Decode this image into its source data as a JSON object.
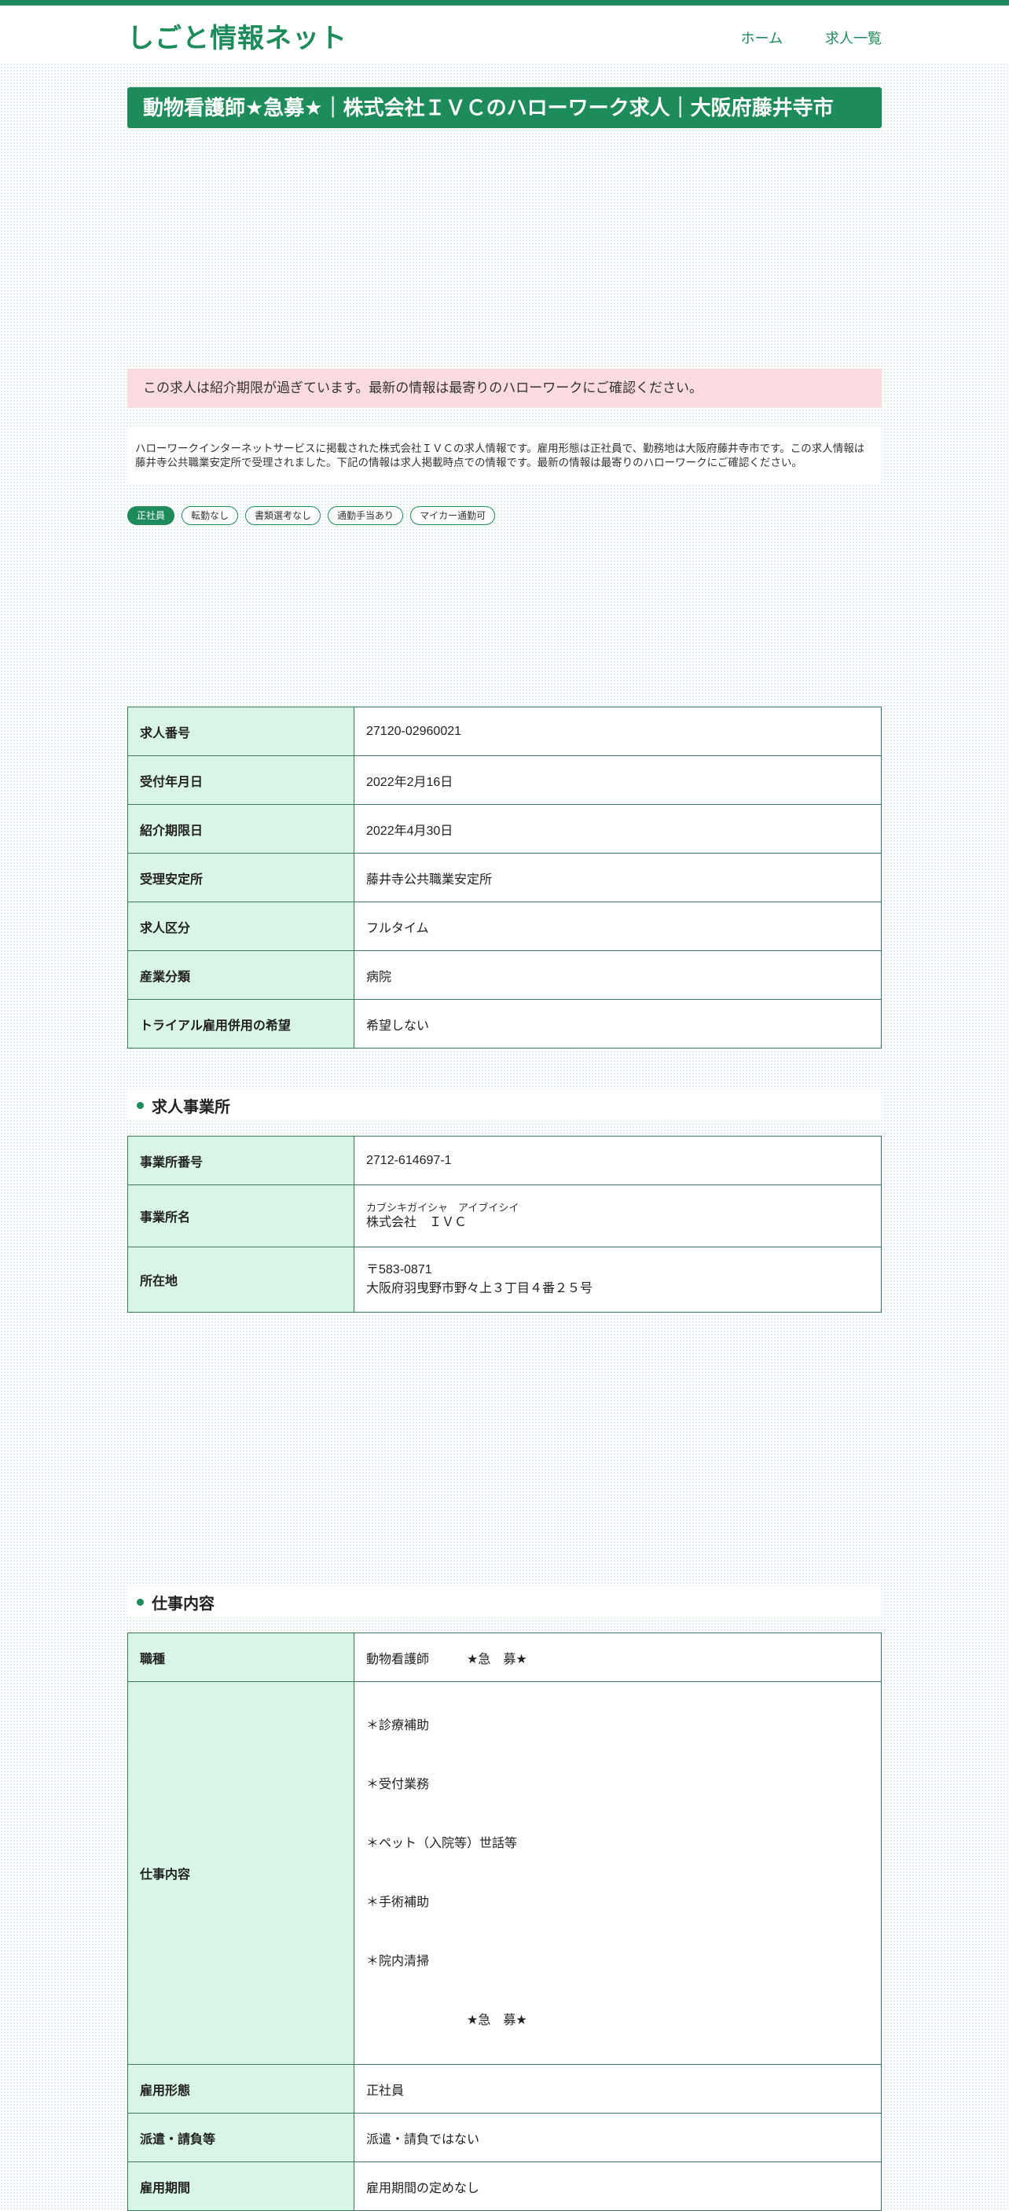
{
  "site": {
    "logo": "しごと情報ネット"
  },
  "nav": {
    "home": "ホーム",
    "jobs": "求人一覧"
  },
  "page_title": "動物看護師★急募★｜株式会社ＩＶＣのハローワーク求人｜大阪府藤井寺市",
  "alert": "この求人は紹介期限が過ぎています。最新の情報は最寄りのハローワークにご確認ください。",
  "intro": "ハローワークインターネットサービスに掲載された株式会社ＩＶＣの求人情報です。雇用形態は正社員で、勤務地は大阪府藤井寺市です。この求人情報は藤井寺公共職業安定所で受理されました。下記の情報は求人掲載時点での情報です。最新の情報は最寄りのハローワークにご確認ください。",
  "tags": [
    "正社員",
    "転勤なし",
    "書類選考なし",
    "通勤手当あり",
    "マイカー通勤可"
  ],
  "job_info": {
    "rows": [
      {
        "key": "求人番号",
        "value": "27120-02960021"
      },
      {
        "key": "受付年月日",
        "value": "2022年2月16日"
      },
      {
        "key": "紹介期限日",
        "value": "2022年4月30日"
      },
      {
        "key": "受理安定所",
        "value": "藤井寺公共職業安定所"
      },
      {
        "key": "求人区分",
        "value": "フルタイム"
      },
      {
        "key": "産業分類",
        "value": "病院"
      },
      {
        "key": "トライアル雇用併用の希望",
        "value": "希望しない"
      }
    ]
  },
  "employer": {
    "heading": "求人事業所",
    "office_no_key": "事業所番号",
    "office_no": "2712-614697-1",
    "name_key": "事業所名",
    "name_kana": "カブシキガイシャ　アイブイシイ",
    "name": "株式会社　ＩＶＣ",
    "address_key": "所在地",
    "postal": "〒583-0871",
    "address": "大阪府羽曳野市野々上３丁目４番２５号"
  },
  "work": {
    "heading": "仕事内容",
    "occupation_key": "職種",
    "occupation": "動物看護師　　　★急　募★",
    "duties_key": "仕事内容",
    "duties": [
      "＊診療補助",
      "＊受付業務",
      "＊ペット（入院等）世話等",
      "＊手術補助",
      "＊院内清掃",
      "　　　　　　　　★急　募★"
    ],
    "employment_type_key": "雇用形態",
    "employment_type": "正社員",
    "dispatch_key": "派遣・請負等",
    "dispatch": "派遣・請負ではない",
    "period_key": "雇用期間",
    "period": "雇用期間の定めなし"
  }
}
